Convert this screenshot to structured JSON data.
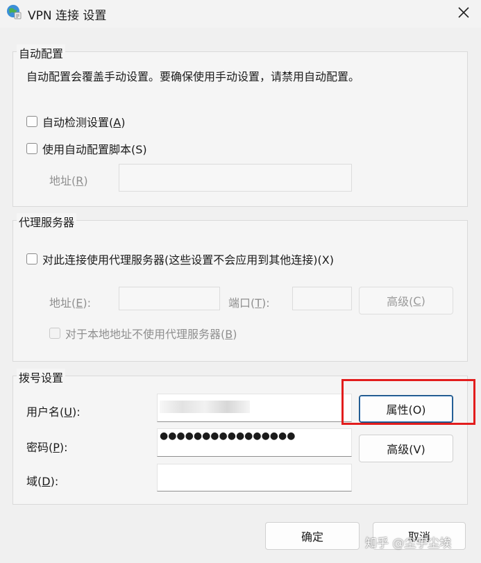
{
  "window": {
    "title": "VPN 连接 设置"
  },
  "auto_config": {
    "legend": "自动配置",
    "note": "自动配置会覆盖手动设置。要确保使用手动设置，请禁用自动配置。",
    "auto_detect": {
      "label": "自动检测设置(",
      "key": "A",
      "end": ")",
      "checked": false
    },
    "auto_script": {
      "label": "使用自动配置脚本(S)",
      "checked": false
    },
    "address": {
      "label": "地址(",
      "key": "R",
      "end": ")",
      "value": ""
    }
  },
  "proxy": {
    "legend": "代理服务器",
    "use_proxy": {
      "label": "对此连接使用代理服务器(这些设置不会应用到其他连接)(X)",
      "checked": false
    },
    "address": {
      "label": "地址(",
      "key": "E",
      "end": "):",
      "value": ""
    },
    "port": {
      "label": "端口(",
      "key": "T",
      "end": "):",
      "value": ""
    },
    "advanced": {
      "label": "高级(",
      "key": "C",
      "end": ")"
    },
    "bypass_local": {
      "label": "对于本地地址不使用代理服务器(",
      "key": "B",
      "end": ")",
      "checked": false
    }
  },
  "dialup": {
    "legend": "拨号设置",
    "username": {
      "label": "用户名(",
      "key": "U",
      "end": "):"
    },
    "password": {
      "label": "密码(",
      "key": "P",
      "end": "):",
      "masked": "●●●●●●●●●●●●●●●●"
    },
    "domain": {
      "label": "域(",
      "key": "D",
      "end": "):",
      "value": ""
    },
    "properties_btn": "属性(O)",
    "advanced_btn": "高级(V)"
  },
  "footer": {
    "ok": "确定",
    "cancel": "取消"
  },
  "watermark": "知乎 @尘宇尘埃",
  "colors": {
    "highlight": "#e21d1d",
    "focus_border": "#1a4f7c"
  }
}
